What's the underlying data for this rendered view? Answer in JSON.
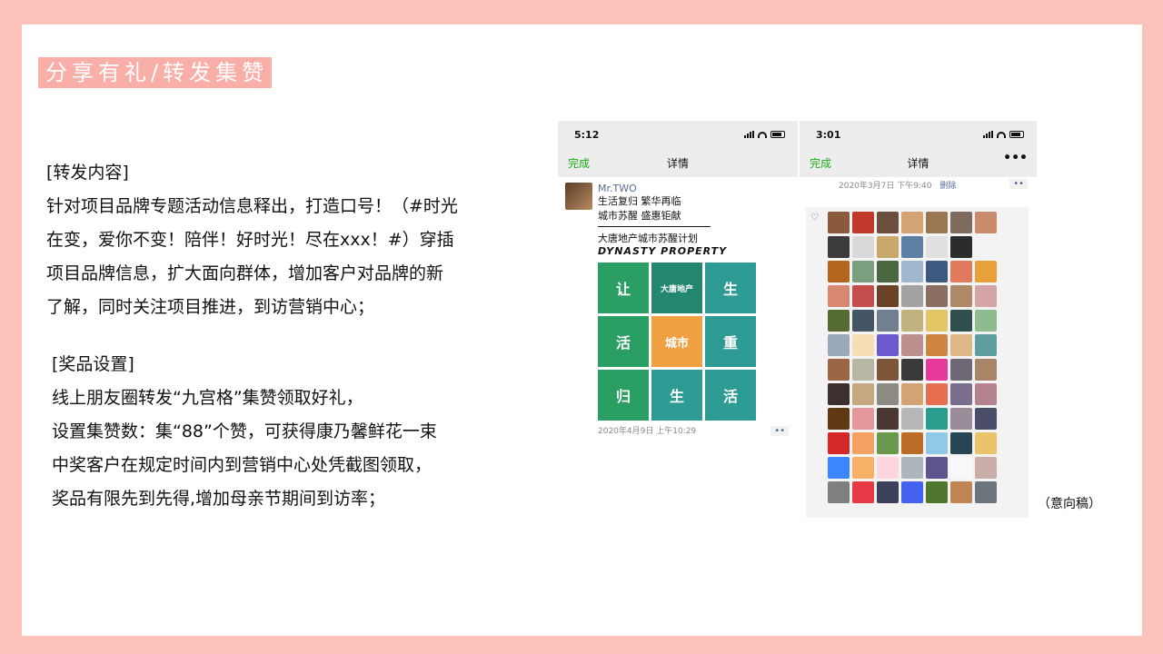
{
  "title": "分享有礼/转发集赞",
  "content_block": {
    "lines": [
      "[转发内容]",
      "针对项目品牌专题活动信息释出，打造口号！（#时光",
      "在变，爱你不变！陪伴！好时光！尽在xxx！#）穿插",
      "项目品牌信息，扩大面向群体，增加客户对品牌的新",
      "了解，同时关注项目推进，到访营销中心；"
    ]
  },
  "prize_block": {
    "lines": [
      "[奖品设置]",
      "线上朋友圈转发“九宫格”集赞领取好礼，",
      "设置集赞数：集“88”个赞，可获得康乃馨鲜花一束",
      "中奖客户在规定时间内到营销中心处凭截图领取，",
      "奖品有限先到先得,增加母亲节期间到访率；"
    ]
  },
  "caption": "（意向稿）",
  "phone1": {
    "time": "5:12",
    "nav": {
      "done": "完成",
      "title": "详情"
    },
    "post": {
      "username": "Mr.TWO",
      "text_lines": [
        "生活复归  繁华再临",
        "城市苏醒  盛惠钜献"
      ],
      "text2": "大唐地产城市苏醒计划",
      "text3": "DYNASTY PROPERTY",
      "grid": [
        "让",
        "大唐地产",
        "生",
        "活",
        "城市",
        "重",
        "归",
        "生",
        "活"
      ],
      "time": "2020年4月9日 上午10:29",
      "dots": "••"
    }
  },
  "phone2": {
    "time": "3:01",
    "nav": {
      "done": "完成",
      "title": "详情",
      "more": "•••"
    },
    "date": "2020年3月7日 下午9:40",
    "delete": "删除",
    "dots": "••",
    "avatar_colors": [
      "#8a5a3c",
      "#c0392b",
      "#6b4e3d",
      "#d4a373",
      "#9b7653",
      "#7d6b5d",
      "#c98b6b",
      "#3b3b3b",
      "#d9d9d9",
      "#c9a66b",
      "#5d7fa3",
      "#e0e0e0",
      "#2c2c2c",
      "#f2f2f2",
      "#b5651d",
      "#7a9e7e",
      "#4a6741",
      "#9fb6cd",
      "#3d5a80",
      "#e07a5f",
      "#e9a03b",
      "#d98870",
      "#c44d4d",
      "#6b4226",
      "#a3a3a3",
      "#8d6e63",
      "#b08968",
      "#d4a5a5",
      "#556b2f",
      "#445566",
      "#708090",
      "#c2b280",
      "#e3c565",
      "#2f4f4f",
      "#8fbc8f",
      "#99aabb",
      "#f5deb3",
      "#6a5acd",
      "#bc8f8f",
      "#cd853f",
      "#deb887",
      "#5f9ea0",
      "#9c6644",
      "#b7b7a4",
      "#7f5539",
      "#3a3a3a",
      "#e6399b",
      "#6d6875",
      "#a98467",
      "#3c2f2f",
      "#c5a880",
      "#8b8b83",
      "#d4a373",
      "#e76f51",
      "#7b6d8d",
      "#b5838d",
      "#603813",
      "#e5989b",
      "#4b3832",
      "#b7b7b7",
      "#2a9d8f",
      "#9a8c98",
      "#4a4e69",
      "#d62828",
      "#f4a261",
      "#6a994e",
      "#bc6c25",
      "#8ecae6",
      "#264653",
      "#e9c46a",
      "#3a86ff",
      "#f7b267",
      "#ffd6e0",
      "#adb5bd",
      "#5e548e",
      "#f8f9fa",
      "#c9ada7",
      "#7f7f7f",
      "#e63946",
      "#3d405b",
      "#4361ee",
      "#4f772d",
      "#c08552",
      "#6c757d"
    ]
  }
}
